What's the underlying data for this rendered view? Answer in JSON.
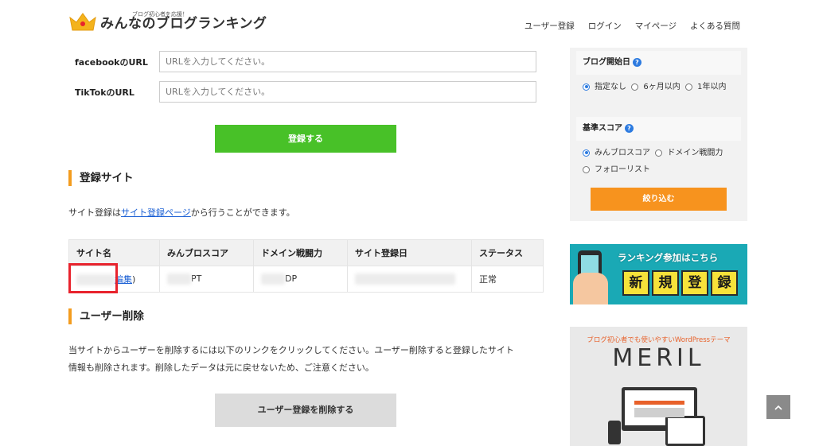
{
  "header": {
    "logo_tagline": "ブログ初心者を応援！",
    "logo_name": "みんなのブログランキング",
    "nav": [
      "ユーザー登録",
      "ログイン",
      "マイページ",
      "よくある質問"
    ]
  },
  "form": {
    "facebook_label": "facebookのURL",
    "facebook_placeholder": "URLを入力してください。",
    "tiktok_label": "TikTokのURL",
    "tiktok_placeholder": "URLを入力してください。",
    "submit_label": "登録する"
  },
  "registered_sites": {
    "title": "登録サイト",
    "desc_before": "サイト登録は",
    "desc_link": "サイト登録ページ",
    "desc_after": "から行うことができます。",
    "columns": [
      "サイト名",
      "みんブロスコア",
      "ドメイン戦闘力",
      "サイト登録日",
      "ステータス"
    ],
    "row": {
      "edit_link": "編集",
      "edit_close": ")",
      "score_unit": "PT",
      "domain_unit": "DP",
      "status": "正常"
    }
  },
  "user_delete": {
    "title": "ユーザー削除",
    "desc_line1": "当サイトからユーザーを削除するには以下のリンクをクリックしてください。ユーザー削除すると登録したサイト",
    "desc_line2": "情報も削除されます。削除したデータは元に戻せないため、ご注意ください。",
    "button_label": "ユーザー登録を削除する"
  },
  "sidebar": {
    "blog_start_title": "ブログ開始日",
    "blog_start_options": [
      "指定なし",
      "6ヶ月以内",
      "1年以内"
    ],
    "blog_start_selected": "指定なし",
    "base_score_title": "基準スコア",
    "base_score_options": [
      "みんブロスコア",
      "ドメイン戦闘力",
      "フォローリスト"
    ],
    "base_score_selected": "みんブロスコア",
    "filter_button": "絞り込む",
    "help_icon": "?"
  },
  "banner_register": {
    "headline": "ランキング参加はこちら",
    "tiles": [
      "新",
      "規",
      "登",
      "録"
    ]
  },
  "banner_meril": {
    "subtitle": "ブログ初心者でも使いやすいWordPressテーマ",
    "title": "MERIL"
  },
  "scroll_top_icon": "chevron-up-icon",
  "colors": {
    "green": "#48c128",
    "orange": "#f7931e",
    "accent_bar": "#f39c1f",
    "link": "#1a5fd4",
    "highlight_red": "#e8232d"
  }
}
